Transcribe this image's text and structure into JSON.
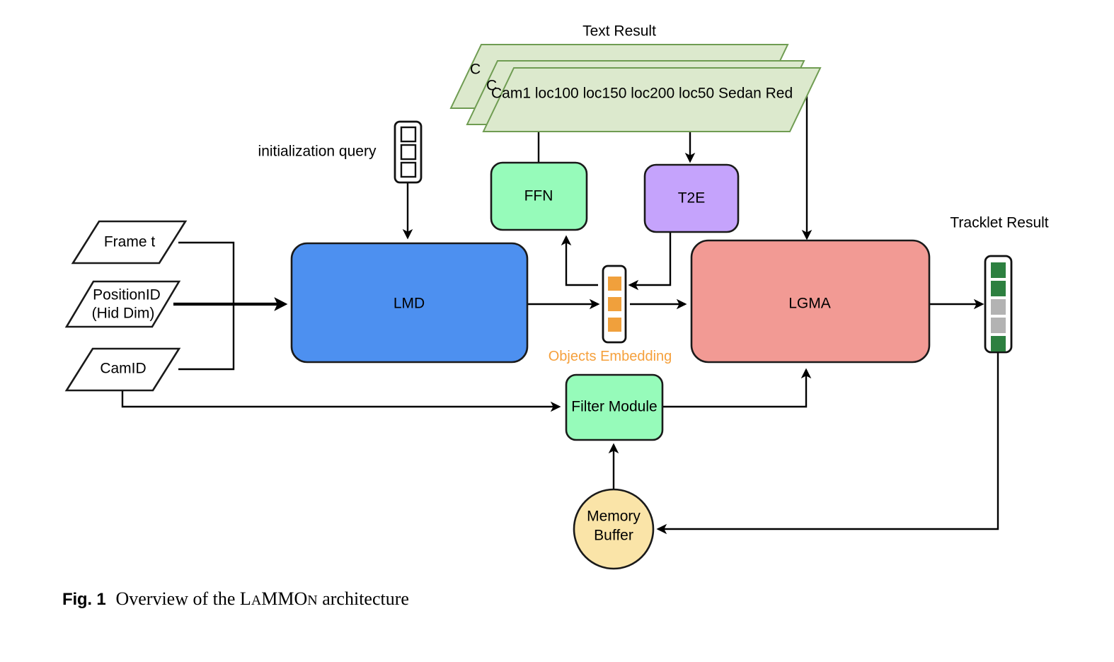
{
  "figure": {
    "caption_number": "Fig. 1",
    "caption_text_pre": "Overview of the ",
    "caption_acronym_parts": [
      "L",
      "A",
      "MMO",
      "N"
    ],
    "caption_text_post": " architecture",
    "caption_full": "Fig. 1   Overview of the LaMMOn architecture"
  },
  "labels": {
    "text_result": "Text Result",
    "tracklet_result": "Tracklet Result",
    "initialization_query": "initialization query",
    "objects_embedding": "Objects Embedding"
  },
  "colors": {
    "lmd_fill": "#4d90f0",
    "ffn_fill": "#96fbba",
    "filter_fill": "#96fbba",
    "t2e_fill": "#c5a3fc",
    "lgma_fill": "#f29a94",
    "memory_fill": "#fae4a8",
    "sheet_fill": "#dce9cd",
    "sheet_stroke": "#6f9c52",
    "objects_embedding_text": "#f5a03c",
    "token_orange": "#f0a03c",
    "tracklet_green": "#2d8040",
    "tracklet_gray": "#b3b3b3",
    "stroke": "#111111",
    "background": "#ffffff"
  },
  "nodes": {
    "lmd": "LMD",
    "ffn": "FFN",
    "t2e": "T2E",
    "lgma": "LGMA",
    "filter_module": "Filter Module",
    "memory_buffer_line1": "Memory",
    "memory_buffer_line2": "Buffer"
  },
  "inputs": [
    {
      "id": "frame",
      "label": "Frame t"
    },
    {
      "id": "position",
      "label_line1": "PositionID",
      "label_line2": "(Hid Dim)"
    },
    {
      "id": "camid",
      "label": "CamID"
    }
  ],
  "text_result": {
    "sheet_count": 3,
    "front_text": "Cam1 loc100 loc150 loc200 loc50 Sedan Red",
    "back_sheet_glyph": "C"
  },
  "objects_embedding_token": {
    "cell_count": 3,
    "cell_colors": [
      "#f0a03c",
      "#f0a03c",
      "#f0a03c"
    ]
  },
  "initialization_query_token": {
    "cell_count": 3,
    "cell_fill": "#ffffff"
  },
  "tracklet_token": {
    "cell_count": 5,
    "cell_colors": [
      "#2d8040",
      "#2d8040",
      "#b3b3b3",
      "#b3b3b3",
      "#2d8040"
    ]
  }
}
